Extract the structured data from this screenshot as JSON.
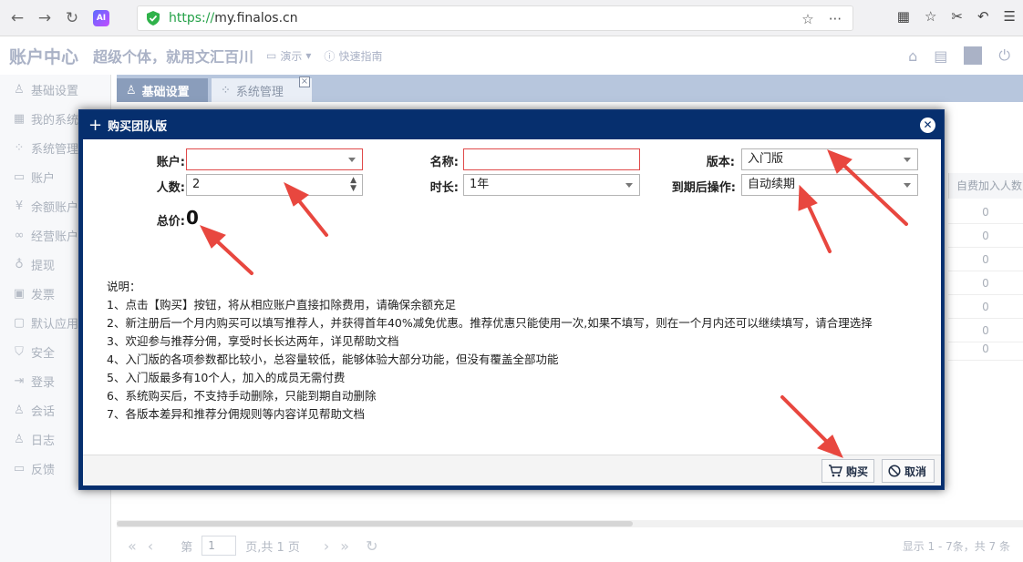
{
  "browser": {
    "url_proto": "https://",
    "url_host": "my.finalos.cn",
    "ai_badge": "AI"
  },
  "header": {
    "title": "账户中心",
    "slogan": "超级个体，就用文汇百川",
    "demo_label": "演示",
    "guide_label": "快速指南"
  },
  "sidebar": {
    "items": [
      {
        "label": "基础设置",
        "icon": "user-icon"
      },
      {
        "label": "我的系统",
        "icon": "grid-icon"
      },
      {
        "label": "系统管理",
        "icon": "dots-icon"
      },
      {
        "label": "账户",
        "icon": "wallet-icon"
      },
      {
        "label": "余额账户",
        "icon": "yen-icon"
      },
      {
        "label": "经营账户",
        "icon": "link-icon"
      },
      {
        "label": "提现",
        "icon": "bag-icon"
      },
      {
        "label": "发票",
        "icon": "invoice-icon"
      },
      {
        "label": "默认应用",
        "icon": "app-icon"
      },
      {
        "label": "安全",
        "icon": "shield-icon"
      },
      {
        "label": "登录",
        "icon": "login-icon"
      },
      {
        "label": "会话",
        "icon": "users-icon"
      },
      {
        "label": "日志",
        "icon": "log-icon"
      },
      {
        "label": "反馈",
        "icon": "chat-icon"
      }
    ]
  },
  "tabs": [
    {
      "label": "基础设置"
    },
    {
      "label": "系统管理"
    }
  ],
  "grid": {
    "column_header": "自费加入人数",
    "cells": [
      "0",
      "0",
      "0",
      "0",
      "0",
      "0",
      "0"
    ]
  },
  "pager": {
    "page_label": "第",
    "page_value": "1",
    "page_suffix": "页,共 1 页",
    "info": "显示 1 - 7条，共 7 条"
  },
  "dialog": {
    "title": "购买团队版",
    "account_label": "账户:",
    "account_value": "",
    "name_label": "名称:",
    "name_value": "",
    "version_label": "版本:",
    "version_value": "入门版",
    "count_label": "人数:",
    "count_value": "2",
    "duration_label": "时长:",
    "duration_value": "1年",
    "expire_label": "到期后操作:",
    "expire_value": "自动续期",
    "total_label": "总价:",
    "total_value": "0",
    "notes": [
      "说明：",
      "1、点击【购买】按钮，将从相应账户直接扣除费用，请确保余额充足",
      "2、新注册后一个月内购买可以填写推荐人，并获得首年40%减免优惠。推荐优惠只能使用一次,如果不填写，则在一个月内还可以继续填写，请合理选择",
      "3、欢迎参与推荐分佣，享受时长长达两年，详见帮助文档",
      "4、入门版的各项参数都比较小，总容量较低，能够体验大部分功能，但没有覆盖全部功能",
      "5、入门版最多有10个人，加入的成员无需付费",
      "6、系统购买后，不支持手动删除，只能到期自动删除",
      "7、各版本差异和推荐分佣规则等内容详见帮助文档"
    ],
    "buy_label": "购买",
    "cancel_label": "取消"
  },
  "colors": {
    "dialog_frame": "#062f6e",
    "error_border": "#e04a4a",
    "arrow": "#e8473f",
    "tab_strip": "#b7c6dd"
  }
}
